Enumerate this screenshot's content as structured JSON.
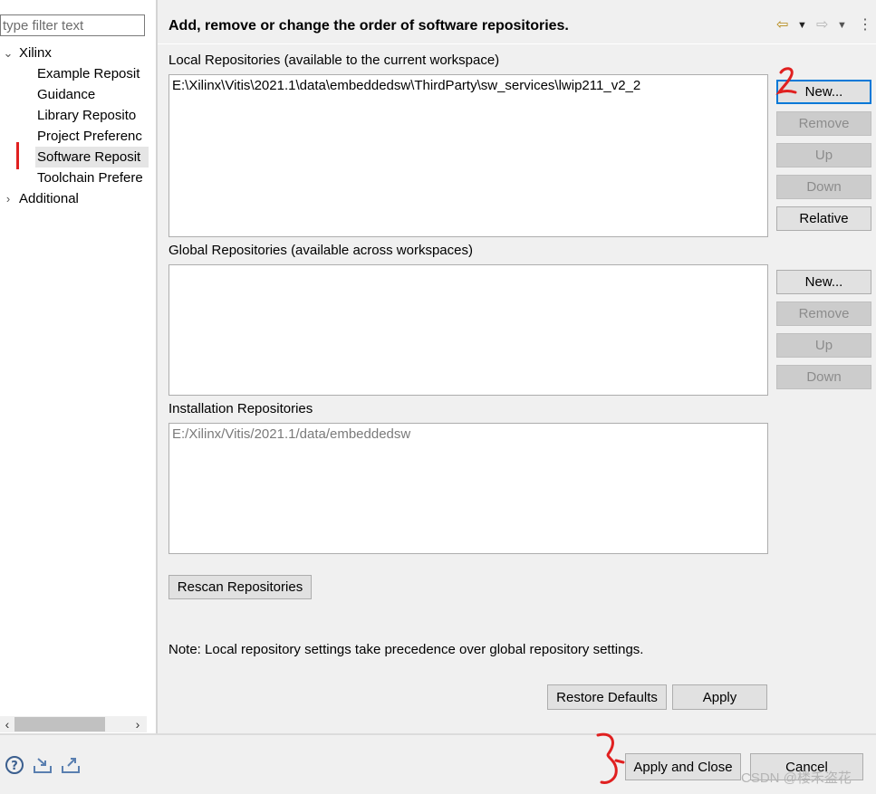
{
  "filter": {
    "placeholder": "type filter text"
  },
  "tree": {
    "items": [
      {
        "label": "Xilinx",
        "expanded": true
      },
      {
        "label": "Example Reposit"
      },
      {
        "label": "Guidance"
      },
      {
        "label": "Library Reposito"
      },
      {
        "label": "Project Preferenc"
      },
      {
        "label": "Software Reposit",
        "selected": true
      },
      {
        "label": "Toolchain Prefere"
      },
      {
        "label": "Additional",
        "expanded": false
      }
    ]
  },
  "page": {
    "title": "Add, remove or change the order of software repositories.",
    "local": {
      "label": "Local Repositories (available to the current workspace)",
      "entries": [
        "E:\\Xilinx\\Vitis\\2021.1\\data\\embeddedsw\\ThirdParty\\sw_services\\lwip211_v2_2"
      ],
      "buttons": {
        "new": "New...",
        "remove": "Remove",
        "up": "Up",
        "down": "Down",
        "relative": "Relative"
      }
    },
    "global": {
      "label": "Global Repositories (available across workspaces)",
      "buttons": {
        "new": "New...",
        "remove": "Remove",
        "up": "Up",
        "down": "Down"
      }
    },
    "installation": {
      "label": "Installation Repositories",
      "entries": [
        "E:/Xilinx/Vitis/2021.1/data/embeddedsw"
      ]
    },
    "rescan_label": "Rescan Repositories",
    "note": "Note: Local repository settings take precedence over global repository settings.",
    "restore_defaults_label": "Restore Defaults",
    "apply_label": "Apply"
  },
  "footer": {
    "apply_close_label": "Apply and Close",
    "cancel_label": "Cancel",
    "watermark": "CSDN @楼禾盗花"
  },
  "icons": {
    "header": [
      "back-arrow-icon",
      "dropdown-icon",
      "forward-arrow-icon",
      "dropdown-icon",
      "view-menu-icon"
    ],
    "footer": [
      "help-icon",
      "import-icon",
      "export-icon"
    ]
  },
  "colors": {
    "annotation": "#e02020",
    "focus": "#0078d7",
    "nav_arrow": "#b68a1a"
  }
}
